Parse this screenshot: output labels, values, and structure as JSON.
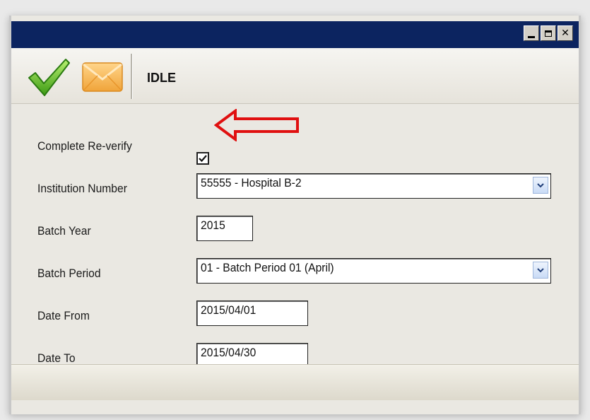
{
  "window": {
    "buttons": {
      "minimize": "minimize",
      "maximize": "maximize",
      "close": "✕"
    }
  },
  "toolbar": {
    "check_icon": "checkmark-icon",
    "mail_icon": "envelope-icon",
    "status": "IDLE"
  },
  "form": {
    "complete_reverify": {
      "label": "Complete Re-verify",
      "checked": true
    },
    "institution_number": {
      "label": "Institution Number",
      "value": "55555 - Hospital B-2"
    },
    "batch_year": {
      "label": "Batch Year",
      "value": "2015"
    },
    "batch_period": {
      "label": "Batch Period",
      "value": "01 - Batch Period 01 (April)"
    },
    "date_from": {
      "label": "Date From",
      "value": "2015/04/01"
    },
    "date_to": {
      "label": "Date To",
      "value": "2015/04/30"
    }
  },
  "annotation": {
    "arrow_color": "#e01010"
  },
  "colors": {
    "titlebar": "#0c2460",
    "panel": "#eae8e2"
  }
}
